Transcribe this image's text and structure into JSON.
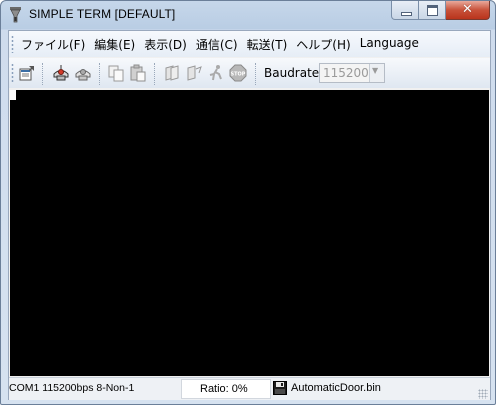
{
  "window": {
    "title": "SIMPLE TERM [DEFAULT]"
  },
  "menu": [
    "ファイル(F)",
    "編集(E)",
    "表示(D)",
    "通信(C)",
    "転送(T)",
    "ヘルプ(H)",
    "Language"
  ],
  "toolbar": {
    "buttons": [
      "properties-icon",
      "connect-icon",
      "disconnect-icon",
      "copy-icon",
      "paste-icon",
      "send-file-icon",
      "receive-file-icon",
      "run-icon",
      "stop-icon"
    ],
    "baud_label": "Baudrate",
    "baud_value": "115200"
  },
  "statusbar": {
    "connection": "COM1 115200bps 8-Non-1",
    "ratio": "Ratio: 0%",
    "file": "AutomaticDoor.bin"
  },
  "colors": {
    "terminal_bg": "#000000",
    "cursor": "#ffffff",
    "close_button": "#c8523a"
  }
}
